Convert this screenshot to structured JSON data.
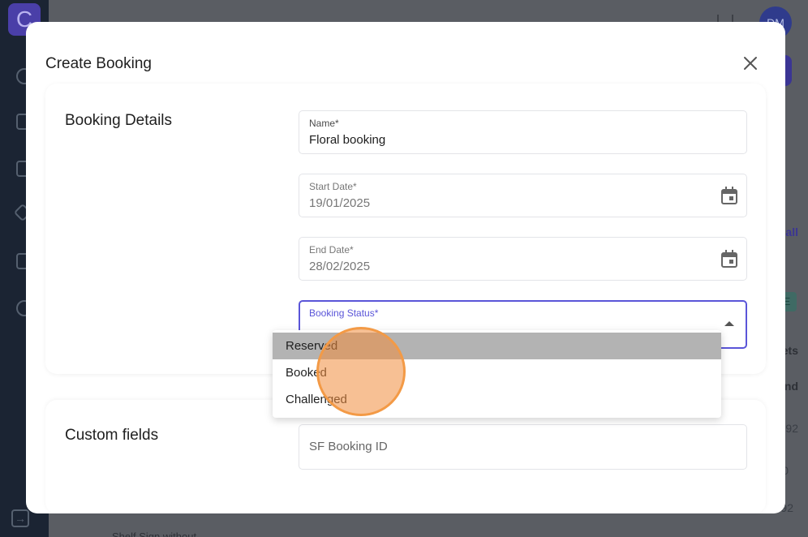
{
  "app": {
    "logo_letter": "C",
    "avatar_initials": "DM"
  },
  "background": {
    "link_fragment": "all",
    "badge": "E",
    "text_fragments": [
      "ets",
      "nd",
      "92",
      "0",
      "92"
    ],
    "bottom_text": "Shelf Sign without"
  },
  "modal": {
    "title": "Create Booking",
    "close_icon": "close-icon",
    "sections": {
      "booking_details": {
        "heading": "Booking Details",
        "name_field": {
          "label": "Name*",
          "value": "Floral booking"
        },
        "start_date": {
          "label": "Start Date*",
          "value": "19/01/2025",
          "icon": "calendar-icon"
        },
        "end_date": {
          "label": "End Date*",
          "value": "28/02/2025",
          "icon": "calendar-icon"
        },
        "status": {
          "label": "Booking Status*",
          "value": "",
          "options": [
            "Reserved",
            "Booked",
            "Challenged"
          ],
          "highlighted": "Reserved"
        }
      },
      "custom_fields": {
        "heading": "Custom fields",
        "sf_booking_id": {
          "placeholder": "SF Booking ID"
        }
      }
    }
  },
  "colors": {
    "accent": "#5a55d8",
    "highlight": "#b3b3b3",
    "click_indicator": "#f39a46"
  }
}
